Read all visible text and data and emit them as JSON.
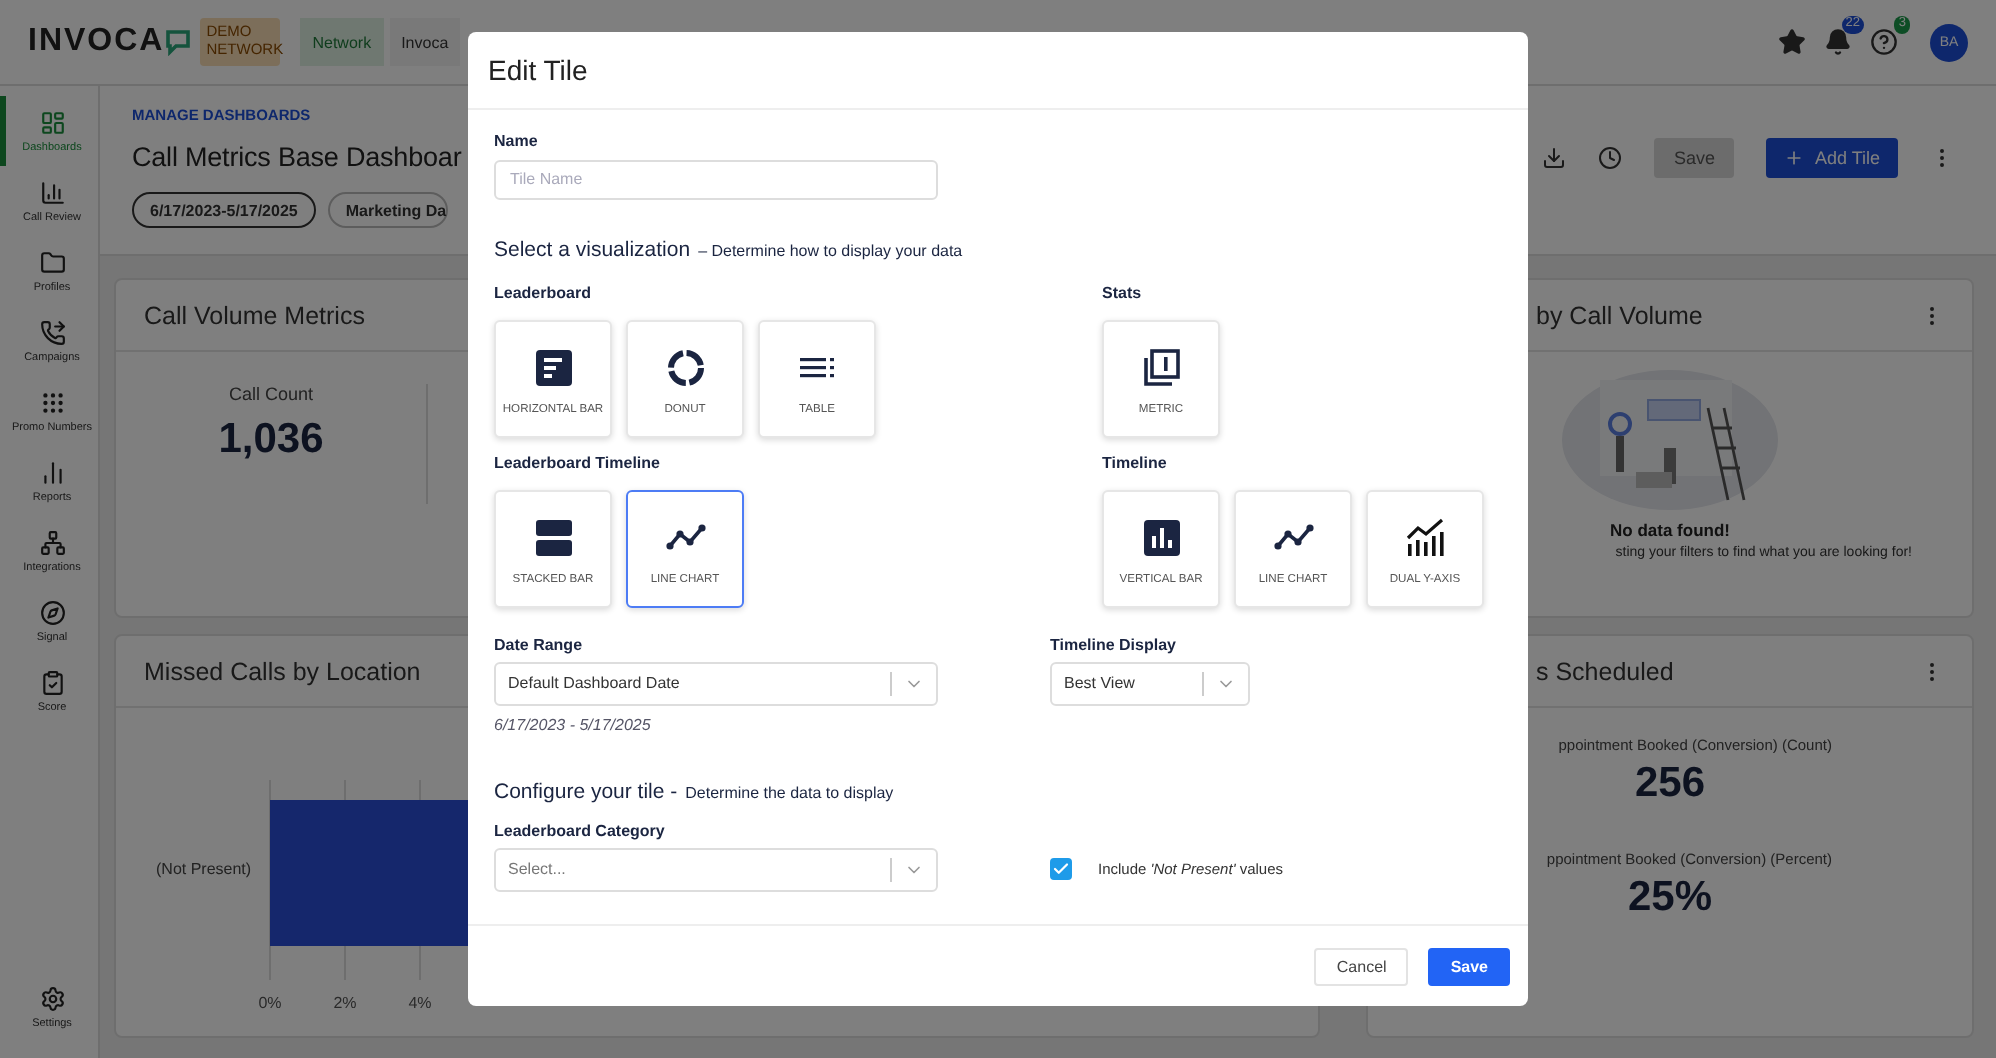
{
  "topbar": {
    "logo": "INVOCA",
    "env_badge": "DEMO NETWORK",
    "tabs": [
      {
        "label": "Network",
        "selected": true
      },
      {
        "label": "Invoca",
        "selected": false
      }
    ],
    "notification_count": "22",
    "help_count": "3",
    "avatar": "BA"
  },
  "sidebar": {
    "items": [
      {
        "label": "Dashboards",
        "selected": true
      },
      {
        "label": "Call Review",
        "selected": false
      },
      {
        "label": "Profiles",
        "selected": false
      },
      {
        "label": "Campaigns",
        "selected": false
      },
      {
        "label": "Promo Numbers",
        "selected": false
      },
      {
        "label": "Reports",
        "selected": false
      },
      {
        "label": "Integrations",
        "selected": false
      },
      {
        "label": "Signal",
        "selected": false
      },
      {
        "label": "Score",
        "selected": false
      }
    ],
    "settings": {
      "label": "Settings",
      "selected": false
    }
  },
  "dashboard": {
    "breadcrumb": "MANAGE DASHBOARDS",
    "title": "Call Metrics Base Dashboar",
    "filters": [
      "6/17/2023-5/17/2025",
      "Marketing Da"
    ],
    "save_button": "Save",
    "add_button": "Add Tile",
    "volume_tile": {
      "title": "Call Volume Metrics",
      "stats": [
        {
          "label": "Call Count",
          "value": "1,036"
        }
      ]
    },
    "call_volume_tile": {
      "title": "by Call Volume",
      "empty_title": "No data found!",
      "empty_text": "sting your filters to find what you are looking for!"
    },
    "missed_tile": {
      "title": "Missed Calls by Location",
      "category": "(Not Present)",
      "ticks": [
        "0%",
        "2%",
        "4%"
      ]
    },
    "scheduled_tile": {
      "title": "s Scheduled",
      "stats": [
        {
          "label": "ppointment Booked (Conversion) (Count)",
          "value": "256"
        },
        {
          "label": "ppointment Booked (Conversion) (Percent)",
          "value": "25%"
        }
      ]
    }
  },
  "modal": {
    "title": "Edit Tile",
    "name_label": "Name",
    "name_placeholder": "Tile Name",
    "viz_heading": {
      "title": "Select a visualization",
      "subtitle": "– Determine how to display your data"
    },
    "viz_groups": [
      {
        "label": "Leaderboard",
        "options": [
          {
            "kind": "horizontal_bar",
            "label": "HORIZONTAL BAR",
            "selected": false
          },
          {
            "kind": "donut",
            "label": "DONUT",
            "selected": false
          },
          {
            "kind": "table",
            "label": "TABLE",
            "selected": false
          }
        ]
      },
      {
        "label": "Stats",
        "options": [
          {
            "kind": "metric",
            "label": "METRIC",
            "selected": false
          }
        ]
      },
      {
        "label": "Leaderboard Timeline",
        "options": [
          {
            "kind": "stacked_bar",
            "label": "STACKED BAR",
            "selected": false
          },
          {
            "kind": "line_chart",
            "label": "LINE CHART",
            "selected": true
          }
        ]
      },
      {
        "label": "Timeline",
        "options": [
          {
            "kind": "vertical_bar",
            "label": "VERTICAL BAR",
            "selected": false
          },
          {
            "kind": "line_chart",
            "label": "LINE CHART",
            "selected": false
          },
          {
            "kind": "dual_axis",
            "label": "DUAL Y-AXIS",
            "selected": false
          }
        ]
      }
    ],
    "date_range": {
      "label": "Date Range",
      "value": "Default Dashboard Date",
      "hint": "6/17/2023 - 5/17/2025"
    },
    "timeline_display": {
      "label": "Timeline Display",
      "value": "Best View"
    },
    "config_heading": {
      "title": "Configure your tile -",
      "subtitle": "Determine the data to display"
    },
    "category": {
      "label": "Leaderboard Category",
      "placeholder": "Select..."
    },
    "include_not_present": {
      "label": "Include *'Not Present'* values",
      "checked": true
    },
    "buttons": [
      {
        "kind": "secondary",
        "label": "Cancel"
      },
      {
        "kind": "primary",
        "label": "Save"
      }
    ]
  }
}
